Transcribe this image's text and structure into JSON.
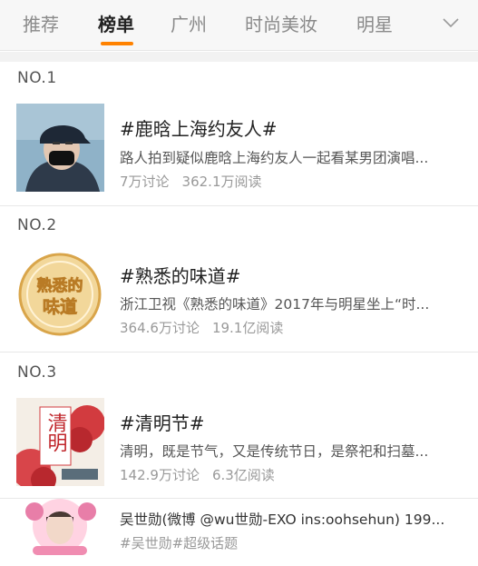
{
  "tabs": [
    {
      "label": "推荐",
      "active": false
    },
    {
      "label": "榜单",
      "active": true
    },
    {
      "label": "广州",
      "active": false
    },
    {
      "label": "时尚美妆",
      "active": false
    },
    {
      "label": "明星",
      "active": false
    }
  ],
  "tab_more_icon": "chevron-down-icon",
  "accent_color": "#ff8200",
  "items": [
    {
      "rank": "NO.1",
      "title": "#鹿晗上海约友人#",
      "desc": "路人拍到疑似鹿晗上海约友人一起看某男团演唱...",
      "discuss": "7万讨论",
      "reads": "362.1万阅读"
    },
    {
      "rank": "NO.2",
      "title": "#熟悉的味道#",
      "desc": "浙江卫视《熟悉的味道》2017年与明星坐上“时...",
      "discuss": "364.6万讨论",
      "reads": "19.1亿阅读",
      "logo_text_1": "熟悉的",
      "logo_text_2": "味道"
    },
    {
      "rank": "NO.3",
      "title": "#清明节#",
      "desc": "清明，既是节气，又是传统节日，是祭祀和扫墓...",
      "discuss": "142.9万讨论",
      "reads": "6.3亿阅读",
      "poster_text": "清明"
    },
    {
      "title": "吴世勋(微博 @wu世勋-EXO ins:oohsehun) 199...",
      "tags": "#吴世勋#超级话题"
    }
  ]
}
